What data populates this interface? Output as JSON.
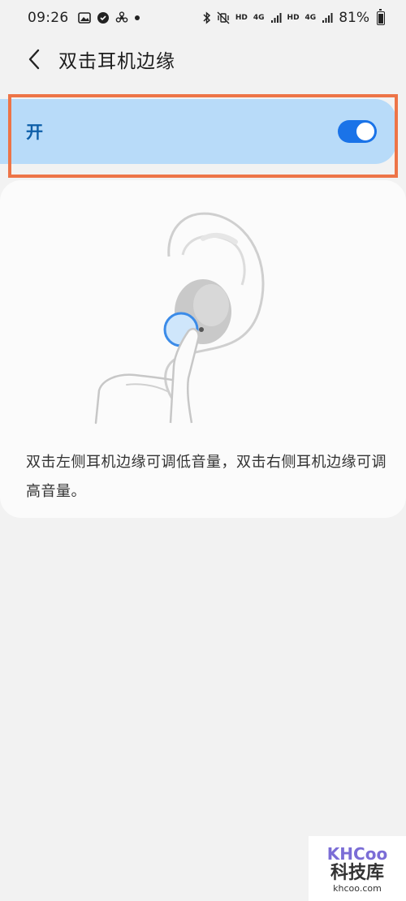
{
  "status_bar": {
    "time": "09:26",
    "network_hd1": "HD",
    "network_4g1": "4G",
    "network_hd2": "HD",
    "network_4g2": "4G",
    "battery": "81%"
  },
  "header": {
    "title": "双击耳机边缘",
    "back_icon": "chevron-left-icon"
  },
  "toggle": {
    "label": "开",
    "state": "on"
  },
  "info": {
    "description": "双击左侧耳机边缘可调低音量，双击右侧耳机边缘可调高音量。"
  },
  "watermark": {
    "logo": "KHCoo",
    "name_cn": "科技库",
    "url": "khcoo.com"
  },
  "colors": {
    "accent": "#1a73e8",
    "toggle_bg": "#b8dbf9",
    "highlight": "#ed7447"
  }
}
